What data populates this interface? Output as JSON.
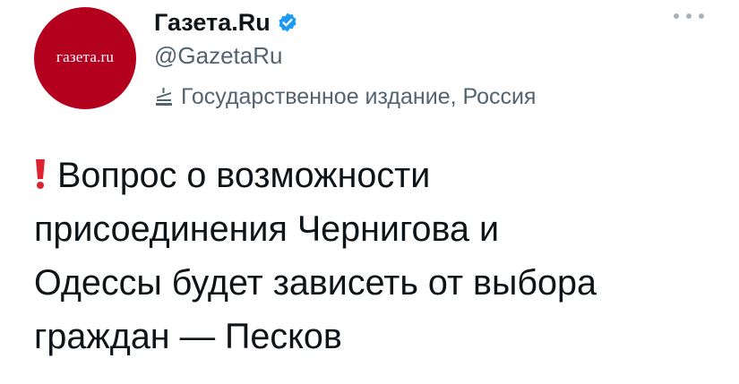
{
  "author": {
    "avatar_text": "газета.ru",
    "display_name": "Газета.Ru",
    "handle": "@GazetaRu",
    "label": "Государственное издание, Россия",
    "avatar_color": "#b3001f",
    "verified_color": "#1d9bf0"
  },
  "icons": {
    "verified": "verified-badge-icon",
    "label": "government-building-icon",
    "more": "more-options-icon",
    "exclamation": "red-exclamation-emoji"
  },
  "tweet": {
    "lines": [
      "Вопрос о возможности",
      "присоединения Чернигова и",
      "Одессы будет зависеть от выбора",
      "граждан — Песков"
    ]
  }
}
